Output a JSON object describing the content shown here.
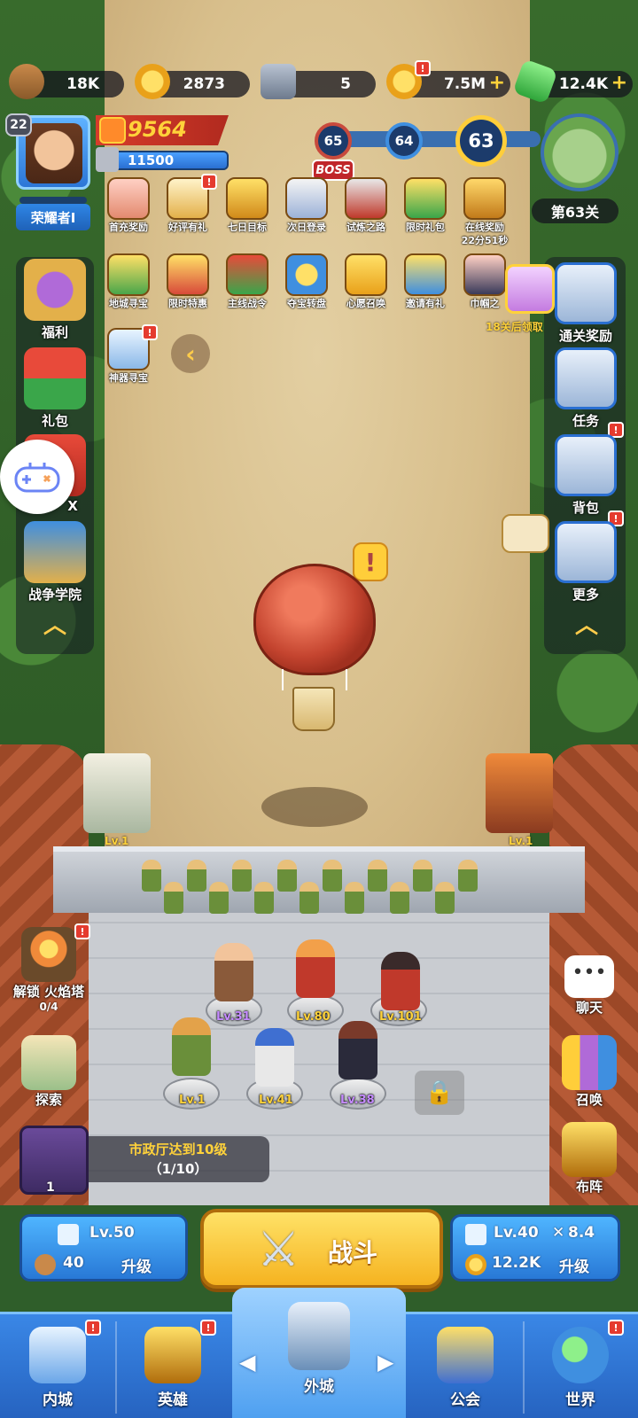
{
  "resources": {
    "wood": "18K",
    "gold_medal": "2873",
    "iron": "5",
    "coins": "7.5M",
    "gems": "12.4K",
    "plus": "+"
  },
  "player": {
    "level": "22",
    "title": "荣耀者Ⅰ",
    "power": "9564",
    "hp": "11500"
  },
  "stage": {
    "node_next2": "65",
    "node_next1": "64",
    "current": "63",
    "boss_label": "BOSS",
    "stage_label": "第63关"
  },
  "events_row1": [
    {
      "label": "首充奖励",
      "icon": "first-recharge-icon"
    },
    {
      "label": "好评有礼",
      "icon": "review-gift-icon"
    },
    {
      "label": "七日目标",
      "icon": "seven-day-icon"
    },
    {
      "label": "次日登录",
      "icon": "next-day-login-icon"
    },
    {
      "label": "试炼之路",
      "icon": "trial-road-icon"
    },
    {
      "label": "限时礼包",
      "icon": "limited-pack-icon"
    },
    {
      "label": "在线奖励",
      "icon": "online-reward-icon",
      "timer": "22分51秒"
    }
  ],
  "events_row2": [
    {
      "label": "地城寻宝",
      "icon": "dungeon-treasure-icon"
    },
    {
      "label": "限时特惠",
      "icon": "limited-sale-icon"
    },
    {
      "label": "主线战令",
      "icon": "battle-pass-icon"
    },
    {
      "label": "夺宝转盘",
      "icon": "treasure-wheel-icon"
    },
    {
      "label": "心愿召唤",
      "icon": "wish-summon-icon"
    },
    {
      "label": "邀请有礼",
      "icon": "invite-gift-icon"
    },
    {
      "label": "巾帼之",
      "icon": "heroine-icon"
    }
  ],
  "events_row3": [
    {
      "label": "神器寻宝",
      "icon": "artifact-treasure-icon"
    }
  ],
  "left_menu": [
    {
      "label": "福利",
      "icon": "welfare-icon"
    },
    {
      "label": "礼包",
      "icon": "gift-pack-icon"
    },
    {
      "label": "X",
      "icon": "hidden-item-icon"
    },
    {
      "label": "战争学院",
      "icon": "war-academy-icon"
    }
  ],
  "right_menu": [
    {
      "label": "通关奖励",
      "icon": "clear-reward-icon"
    },
    {
      "label": "任务",
      "icon": "task-icon"
    },
    {
      "label": "背包",
      "icon": "backpack-icon"
    },
    {
      "label": "更多",
      "icon": "more-icon"
    }
  ],
  "reward_hint": "18关后领取",
  "towers": {
    "left_lvl": "Lv.1",
    "right_lvl": "Lv.1"
  },
  "heroes": [
    {
      "level": "Lv.31",
      "tier": "purple"
    },
    {
      "level": "Lv.80",
      "tier": "gold"
    },
    {
      "level": "Lv.101",
      "tier": "gold"
    },
    {
      "level": "Lv.1",
      "tier": "gold"
    },
    {
      "level": "Lv.41",
      "tier": "gold"
    },
    {
      "level": "Lv.38",
      "tier": "purple"
    }
  ],
  "lower_left": {
    "unlock_label": "解锁 火焰塔",
    "unlock_progress": "0/4",
    "explore_label": "探索"
  },
  "lower_right": {
    "chat_label": "聊天",
    "summon_label": "召唤",
    "formation_label": "布阵"
  },
  "quest": {
    "count": "1",
    "line1": "市政厅达到10级",
    "line2": "（1/10）"
  },
  "left_build": {
    "level": "Lv.50",
    "cost": "40",
    "action": "升级"
  },
  "battle_label": "战斗",
  "right_build": {
    "level": "Lv.40",
    "speed": "8.4",
    "cost": "12.2K",
    "action": "升级"
  },
  "nav": [
    {
      "label": "内城",
      "icon": "inner-city-icon"
    },
    {
      "label": "英雄",
      "icon": "hero-icon"
    },
    {
      "label": "外城",
      "icon": "outer-city-icon"
    },
    {
      "label": "公会",
      "icon": "guild-icon"
    },
    {
      "label": "世界",
      "icon": "world-icon"
    }
  ],
  "alert_mark": "!",
  "colors": {
    "accent_gold": "#ffd23a",
    "alert_red": "#e53b2f",
    "nav_blue": "#2663c0"
  }
}
